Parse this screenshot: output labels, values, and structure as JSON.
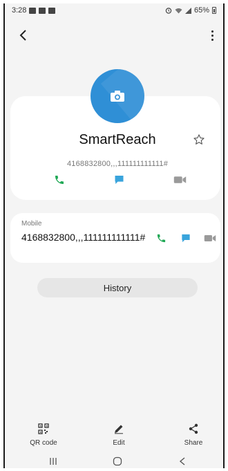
{
  "status_bar": {
    "time": "3:28",
    "battery": "65%",
    "icons_left": [
      "image-icon",
      "mail-icon",
      "b-app-icon"
    ],
    "icons_right": [
      "alarm-icon",
      "wifi-icon",
      "signal-icon",
      "battery-icon"
    ]
  },
  "toolbar": {
    "back_icon": "back-arrow-icon",
    "more_icon": "more-vert-icon"
  },
  "contact": {
    "avatar_icon": "camera-icon",
    "name": "SmartReach",
    "number": "4168832800,,,111111111111#",
    "favorite_icon": "star-outline-icon",
    "actions": [
      "call-icon",
      "message-icon",
      "video-call-icon"
    ]
  },
  "mobile": {
    "label": "Mobile",
    "number": "4168832800,,,111111111111#"
  },
  "history": {
    "label": "History"
  },
  "bottom_toolbar": {
    "items": [
      {
        "label": "QR code",
        "icon": "qr-code-icon"
      },
      {
        "label": "Edit",
        "icon": "edit-pen-icon"
      },
      {
        "label": "Share",
        "icon": "share-icon"
      }
    ]
  },
  "nav_bar": {
    "items": [
      "recents-icon",
      "home-icon",
      "back-nav-icon"
    ]
  },
  "colors": {
    "avatar": "#2f8fd6",
    "call": "#1fa855",
    "message": "#39a4dc",
    "video": "#9a9a9a",
    "background": "#f4f4f4",
    "card": "#ffffff"
  }
}
